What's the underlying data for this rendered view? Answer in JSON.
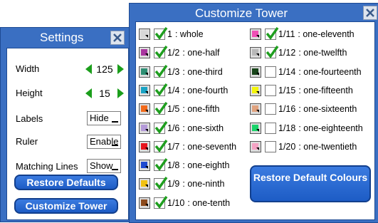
{
  "settings": {
    "title": "Settings",
    "width_label": "Width",
    "width_value": "125",
    "height_label": "Height",
    "height_value": "15",
    "labels_label": "Labels",
    "labels_value": "Hide",
    "ruler_label": "Ruler",
    "ruler_value": "Enable",
    "matching_label": "Matching Lines",
    "matching_value": "Show",
    "restore_defaults": "Restore Defaults",
    "customize_tower": "Customize Tower"
  },
  "tower": {
    "title": "Customize Tower",
    "restore_colours": "Restore Default Colours",
    "items": [
      {
        "frac": "1",
        "name": ": whole",
        "color": "#d8d8d8",
        "checked": true
      },
      {
        "frac": "1/2",
        "name": ": one-half",
        "color": "#a8359e",
        "checked": true
      },
      {
        "frac": "1/3",
        "name": ": one-third",
        "color": "#2e8f74",
        "checked": true
      },
      {
        "frac": "1/4",
        "name": ": one-fourth",
        "color": "#1aa3c4",
        "checked": true
      },
      {
        "frac": "1/5",
        "name": ": one-fifth",
        "color": "#f26a1b",
        "checked": true
      },
      {
        "frac": "1/6",
        "name": ": one-sixth",
        "color": "#b49ad8",
        "checked": true
      },
      {
        "frac": "1/7",
        "name": ": one-seventh",
        "color": "#e8141d",
        "checked": true
      },
      {
        "frac": "1/8",
        "name": ": one-eighth",
        "color": "#1e49d0",
        "checked": true
      },
      {
        "frac": "1/9",
        "name": ": one-ninth",
        "color": "#f2c211",
        "checked": true
      },
      {
        "frac": "1/10",
        "name": ": one-tenth",
        "color": "#8c4a1c",
        "checked": true
      },
      {
        "frac": "1/11",
        "name": ": one-eleventh",
        "color": "#f04fb5",
        "checked": true
      },
      {
        "frac": "1/12",
        "name": ": one-twelfth",
        "color": "#b8b8b8",
        "checked": true
      },
      {
        "frac": "1/14",
        "name": ": one-fourteenth",
        "color": "#18451a",
        "checked": false
      },
      {
        "frac": "1/15",
        "name": ": one-fifteenth",
        "color": "#f4f50a",
        "checked": false
      },
      {
        "frac": "1/16",
        "name": ": one-sixteenth",
        "color": "#e0a27e",
        "checked": false
      },
      {
        "frac": "1/18",
        "name": ": one-eighteenth",
        "color": "#1ad36a",
        "checked": false
      },
      {
        "frac": "1/20",
        "name": ": one-twentieth",
        "color": "#f5a3c4",
        "checked": false
      }
    ]
  }
}
